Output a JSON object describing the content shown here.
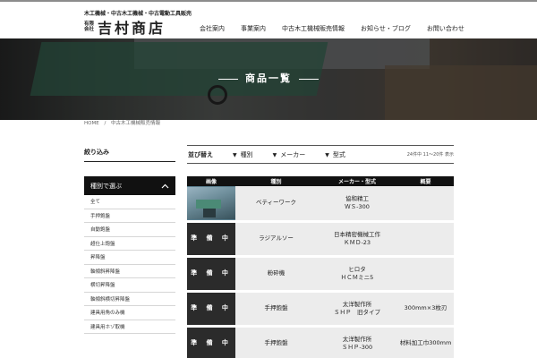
{
  "header": {
    "tagline": "木工機械・中古木工機械・中古電動工具販売",
    "logo_prefix_1": "有限",
    "logo_prefix_2": "会社",
    "logo_name": "吉村商店",
    "nav": [
      "会社案内",
      "事業案内",
      "中古木工機械販売情報",
      "お知らせ・ブログ",
      "お問い合わせ"
    ]
  },
  "hero": {
    "title": "商品一覧"
  },
  "breadcrumb": {
    "home": "HOME",
    "sep": "/",
    "current": "中古木工機械販売情報"
  },
  "sidebar": {
    "filter_title": "絞り込み",
    "category_heading": "種別で選ぶ",
    "categories": [
      "全て",
      "手押鉋盤",
      "自動鉋盤",
      "超仕上鉋盤",
      "昇降盤",
      "軸傾斜昇降盤",
      "横切昇降盤",
      "軸傾斜横切昇降盤",
      "建具用角のみ機",
      "建具用ホゾ取機"
    ]
  },
  "sortbar": {
    "sort_label": "並び替え",
    "dropdowns": [
      "種別",
      "メーカー",
      "型式"
    ],
    "count": "24件中 11〜20件 表示"
  },
  "table": {
    "headers": [
      "画像",
      "種別",
      "メーカー・型式",
      "概要"
    ],
    "rows": [
      {
        "image": "photo",
        "type": "ベティーワーク",
        "maker": "協和精工",
        "model": "ＷＳ-300",
        "summary": ""
      },
      {
        "image": "準 備 中",
        "type": "ラジアルソー",
        "maker": "日本精密機械工作",
        "model": "ＫＭＤ-23",
        "summary": ""
      },
      {
        "image": "準 備 中",
        "type": "粉砕機",
        "maker": "ヒロタ",
        "model": "ＨＣＭミニ5",
        "summary": ""
      },
      {
        "image": "準 備 中",
        "type": "手押鉋盤",
        "maker": "太洋製作所",
        "model": "ＳＨＰ　旧タイプ",
        "summary": "300mm×3枚刃"
      },
      {
        "image": "準 備 中",
        "type": "手押鉋盤",
        "maker": "太洋製作所",
        "model": "ＳＨＰ-300",
        "summary": "材料加工巾300mm"
      }
    ]
  },
  "colors": {
    "dark": "#111111",
    "row_bg": "#ececec",
    "text": "#222222"
  }
}
